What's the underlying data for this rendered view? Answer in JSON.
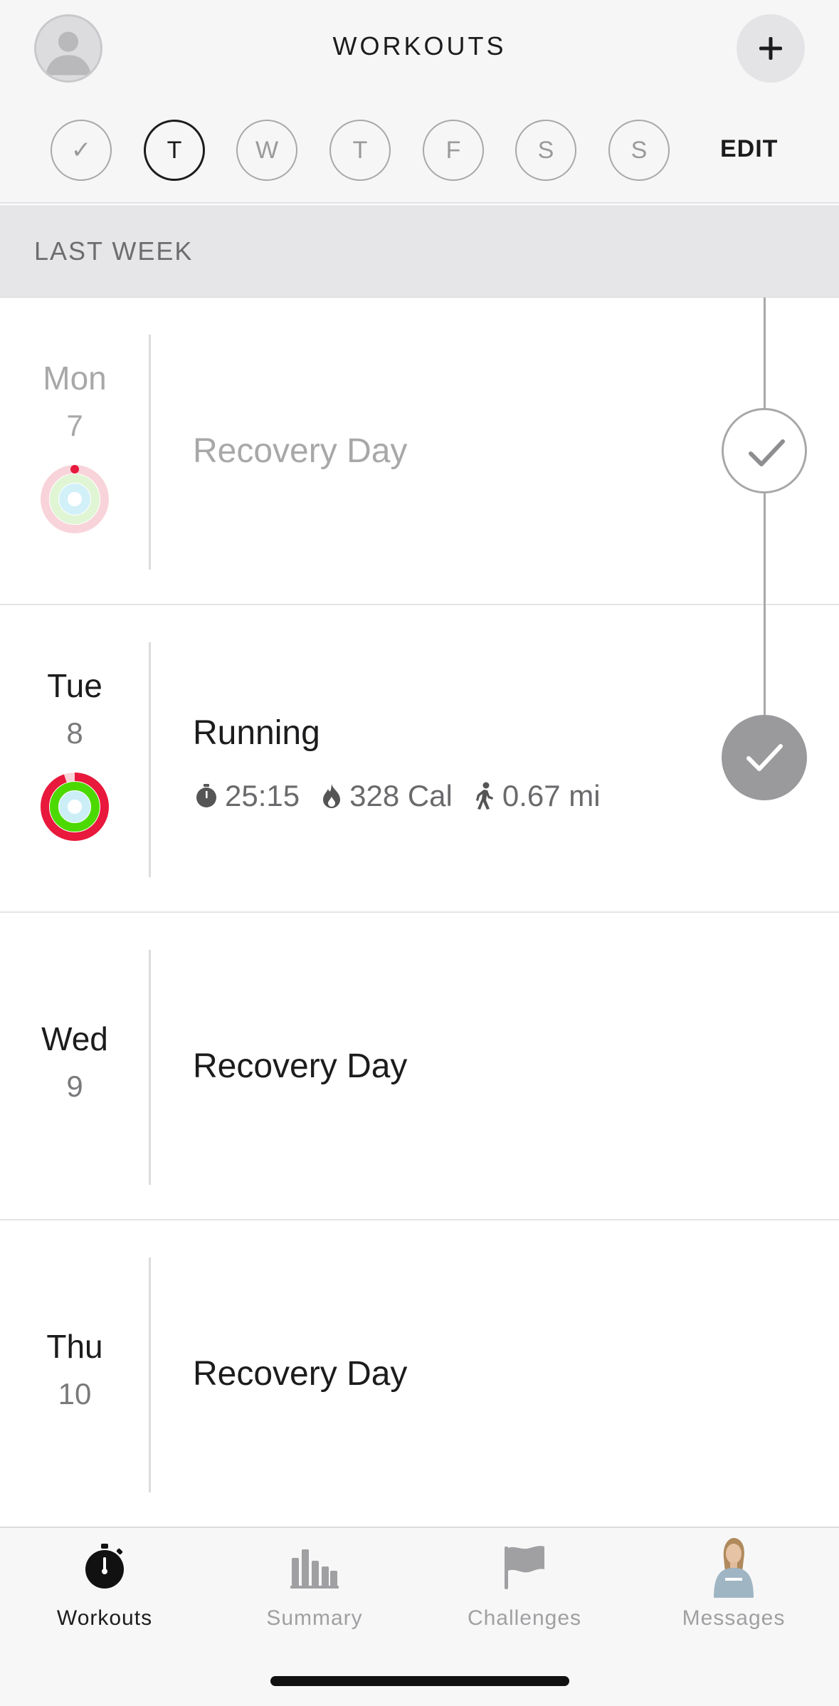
{
  "header": {
    "title": "WORKOUTS",
    "edit_label": "EDIT",
    "week_days": [
      "✓",
      "T",
      "W",
      "T",
      "F",
      "S",
      "S"
    ],
    "current_day_index": 1
  },
  "section": {
    "label": "LAST WEEK"
  },
  "days": [
    {
      "name": "Mon",
      "number": "7",
      "title": "Recovery Day",
      "status": "done-outline",
      "faded": true
    },
    {
      "name": "Tue",
      "number": "8",
      "title": "Running",
      "status": "done-filled",
      "faded": false,
      "stats": {
        "duration": "25:15",
        "calories": "328 Cal",
        "distance": "0.67 mi"
      }
    },
    {
      "name": "Wed",
      "number": "9",
      "title": "Recovery Day",
      "status": "none",
      "faded": false
    },
    {
      "name": "Thu",
      "number": "10",
      "title": "Recovery Day",
      "status": "none",
      "faded": false
    }
  ],
  "tabs": [
    {
      "label": "Workouts",
      "icon": "stopwatch-icon",
      "active": true
    },
    {
      "label": "Summary",
      "icon": "bar-chart-icon",
      "active": false
    },
    {
      "label": "Challenges",
      "icon": "flag-icon",
      "active": false
    },
    {
      "label": "Messages",
      "icon": "coach-avatar",
      "active": false
    }
  ],
  "colors": {
    "text_primary": "#1c1c1e",
    "text_faded": "#a8a8aa",
    "ring_move": "#e8193c",
    "ring_exercise": "#4cd900",
    "ring_stand": "#1ec8e8",
    "check_filled": "#9a9a9c"
  }
}
